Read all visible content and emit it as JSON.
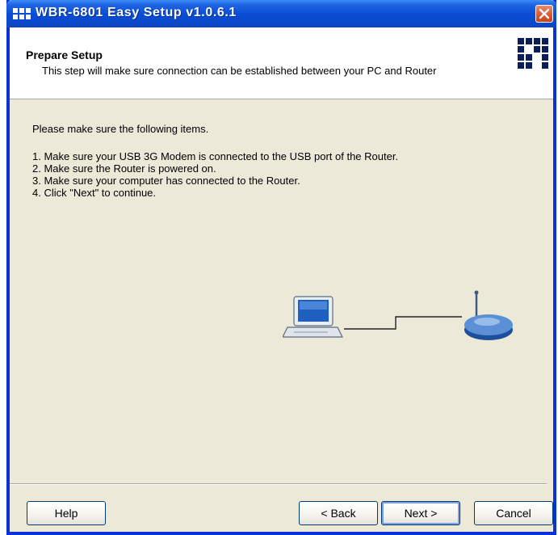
{
  "window": {
    "title": "WBR-6801 Easy Setup v1.0.6.1"
  },
  "header": {
    "title": "Prepare Setup",
    "description": "This step will make sure connection can be established between your PC and Router"
  },
  "content": {
    "intro": "Please make sure the following items.",
    "items": [
      "1. Make sure your USB 3G Modem is connected to the USB port of the Router.",
      "2. Make sure the Router is powered on.",
      "3. Make sure your computer has connected to the Router.",
      "4. Click \"Next\" to continue."
    ]
  },
  "buttons": {
    "help": "Help",
    "back": "< Back",
    "next": "Next >",
    "cancel": "Cancel"
  },
  "colors": {
    "titlebar": "#0a4fd6",
    "window_bg": "#ece9d8",
    "logo": "#0c1d5c"
  },
  "icons": [
    "app-icon",
    "close-icon",
    "levelone-logo",
    "computer-icon",
    "router-icon"
  ]
}
